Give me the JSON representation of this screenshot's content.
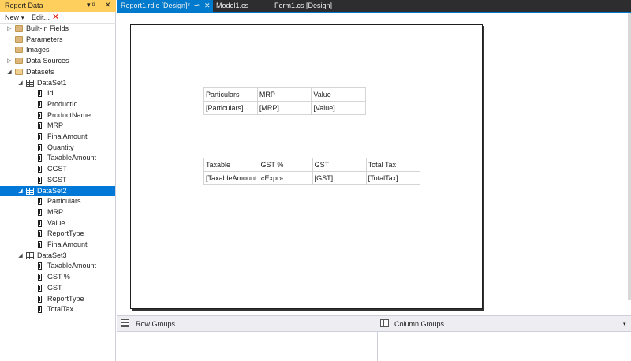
{
  "report_data_panel": {
    "title": "Report Data",
    "pin_glyph": "▾ ᵖ",
    "close_glyph": "✕",
    "toolbar": {
      "new_label": "New ▾",
      "edit_label": "Edit...",
      "delete_glyph": "✕"
    },
    "tree": [
      {
        "label": "Built-in Fields",
        "icon": "folder-icon",
        "level": 0,
        "expander": "▷"
      },
      {
        "label": "Parameters",
        "icon": "folder-icon",
        "level": 0,
        "expander": ""
      },
      {
        "label": "Images",
        "icon": "folder-icon",
        "level": 0,
        "expander": ""
      },
      {
        "label": "Data Sources",
        "icon": "folder-icon",
        "level": 0,
        "expander": "▷"
      },
      {
        "label": "Datasets",
        "icon": "folder-open-icon",
        "level": 0,
        "expander": "◢"
      },
      {
        "label": "DataSet1",
        "icon": "table-icon",
        "level": 1,
        "expander": "◢"
      },
      {
        "label": "Id",
        "icon": "field-icon",
        "level": 2
      },
      {
        "label": "ProductId",
        "icon": "field-icon",
        "level": 2
      },
      {
        "label": "ProductName",
        "icon": "field-icon",
        "level": 2
      },
      {
        "label": "MRP",
        "icon": "field-icon",
        "level": 2
      },
      {
        "label": "FinalAmount",
        "icon": "field-icon",
        "level": 2
      },
      {
        "label": "Quantity",
        "icon": "field-icon",
        "level": 2
      },
      {
        "label": "TaxableAmount",
        "icon": "field-icon",
        "level": 2
      },
      {
        "label": "CGST",
        "icon": "field-icon",
        "level": 2
      },
      {
        "label": "SGST",
        "icon": "field-icon",
        "level": 2
      },
      {
        "label": "DataSet2",
        "icon": "table-icon",
        "level": 1,
        "expander": "◢",
        "selected": true
      },
      {
        "label": "Particulars",
        "icon": "field-icon",
        "level": 2
      },
      {
        "label": "MRP",
        "icon": "field-icon",
        "level": 2
      },
      {
        "label": "Value",
        "icon": "field-icon",
        "level": 2
      },
      {
        "label": "ReportType",
        "icon": "field-icon",
        "level": 2
      },
      {
        "label": "FinalAmount",
        "icon": "field-icon",
        "level": 2
      },
      {
        "label": "DataSet3",
        "icon": "table-icon",
        "level": 1,
        "expander": "◢"
      },
      {
        "label": "TaxableAmount",
        "icon": "field-icon",
        "level": 2
      },
      {
        "label": "GST %",
        "icon": "field-icon",
        "level": 2
      },
      {
        "label": "GST",
        "icon": "field-icon",
        "level": 2
      },
      {
        "label": "ReportType",
        "icon": "field-icon",
        "level": 2
      },
      {
        "label": "TotalTax",
        "icon": "field-icon",
        "level": 2
      }
    ]
  },
  "tabs": [
    {
      "label": "Report1.rdlc [Design]*",
      "active": true,
      "pin": "⊸",
      "close": "✕"
    },
    {
      "label": "Model1.cs",
      "active": false
    },
    {
      "label": "Form1.cs [Design]",
      "active": false
    }
  ],
  "report": {
    "table1": {
      "header": [
        "Particulars",
        "MRP",
        "Value"
      ],
      "detail": [
        "[Particulars]",
        "[MRP]",
        "[Value]"
      ]
    },
    "table2": {
      "header": [
        "Taxable",
        "GST %",
        "GST",
        "Total Tax"
      ],
      "detail": [
        "[TaxableAmount",
        "«Expr»",
        "[GST]",
        "[TotalTax]"
      ]
    }
  },
  "grouping": {
    "row_groups_label": "Row Groups",
    "column_groups_label": "Column Groups"
  },
  "colors": {
    "panel_title_bg": "#ffcf5e",
    "selection": "#0078d7",
    "tab_strip": "#2d2d30",
    "tab_active": "#007acc",
    "delete_red": "#e51400"
  }
}
